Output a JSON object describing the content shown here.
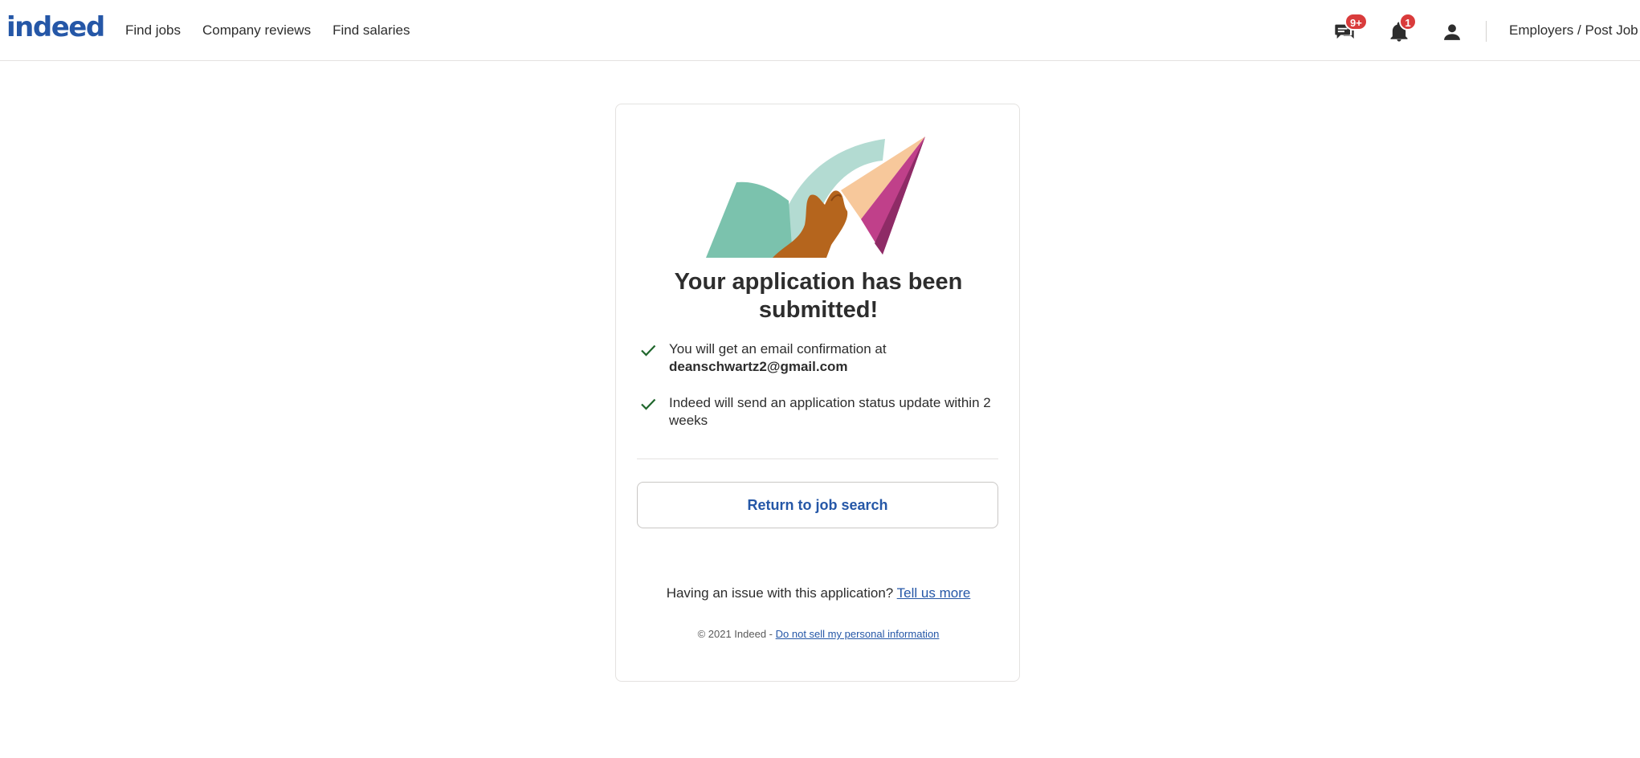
{
  "header": {
    "logo_text": "indeed",
    "nav": [
      {
        "label": "Find jobs"
      },
      {
        "label": "Company reviews"
      },
      {
        "label": "Find salaries"
      }
    ],
    "messages_badge": "9+",
    "notifications_badge": "1",
    "employers_label": "Employers / Post Job"
  },
  "confirmation": {
    "title": "Your application has been submitted!",
    "items": [
      {
        "text": "You will get an email confirmation at",
        "email": "deanschwartz2@gmail.com"
      },
      {
        "text": "Indeed will send an application status update within 2 weeks"
      }
    ],
    "return_button": "Return to job search",
    "issue_text": "Having an issue with this application?",
    "issue_link": "Tell us more",
    "copyright": "© 2021 Indeed -",
    "privacy_link": "Do not sell my personal information"
  },
  "colors": {
    "brand_blue": "#2557a7",
    "badge_red": "#d93b3b",
    "check_green": "#1f662c"
  },
  "icons": {
    "messages": "chat-icon",
    "notifications": "bell-icon",
    "profile": "person-icon",
    "check": "checkmark-icon"
  }
}
